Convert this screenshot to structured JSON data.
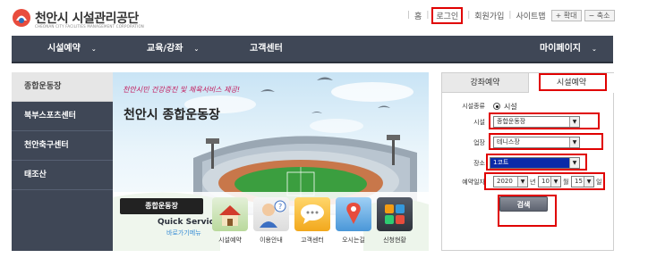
{
  "logo": {
    "title": "천안시 시설관리공단",
    "subtitle": "CHEONAN CITY FACILITIES MANAGEMENT CORPORATION"
  },
  "top_nav": {
    "home": "홈",
    "login": "로그인",
    "join": "회원가입",
    "sitemap": "사이트맵",
    "zoom_in": "+ 확대",
    "zoom_out": "− 축소"
  },
  "gnb": {
    "items": [
      {
        "label": "시설예약",
        "caret": "⌄"
      },
      {
        "label": "교육/강좌",
        "caret": "⌄"
      },
      {
        "label": "고객센터",
        "caret": ""
      },
      {
        "label": "마이페이지",
        "caret": "⌄"
      }
    ]
  },
  "lnb": {
    "items": [
      {
        "label": "종합운동장",
        "active": true
      },
      {
        "label": "북부스포츠센터",
        "active": false
      },
      {
        "label": "천안축구센터",
        "active": false
      },
      {
        "label": "태조산",
        "active": false
      }
    ]
  },
  "hero": {
    "tagline": "천안시민 건강증진 및 체육서비스 제공!",
    "title": "천안시 종합운동장"
  },
  "quick_service": {
    "label": "종합운동장",
    "title": "Quick Service",
    "subtitle": "바로가기메뉴",
    "buttons": [
      {
        "label": "시설예약",
        "icon": "house-icon"
      },
      {
        "label": "이용안내",
        "icon": "info-person-icon"
      },
      {
        "label": "고객센터",
        "icon": "chat-bubble-icon"
      },
      {
        "label": "오시는길",
        "icon": "map-pin-icon"
      },
      {
        "label": "신청현황",
        "icon": "grid-apps-icon"
      }
    ]
  },
  "search_panel": {
    "tabs": [
      "강좌예약",
      "시설예약"
    ],
    "active_tab": "시설예약",
    "labels": {
      "facility_type": "시설종류",
      "facility": "시설",
      "sport": "업장",
      "place": "장소",
      "date": "예약일자"
    },
    "facility_type_option": "시설",
    "facility_value": "종합운동장",
    "sport_value": "테니스장",
    "place_value": "1코트",
    "date": {
      "year": "2020",
      "year_unit": "년",
      "month": "10",
      "month_unit": "월",
      "day": "15",
      "day_unit": "일"
    },
    "search_button": "검색"
  },
  "colors": {
    "nav_bg": "#3f4756",
    "highlight_box": "#e00000",
    "selected_option_bg": "#0a2aa8"
  }
}
